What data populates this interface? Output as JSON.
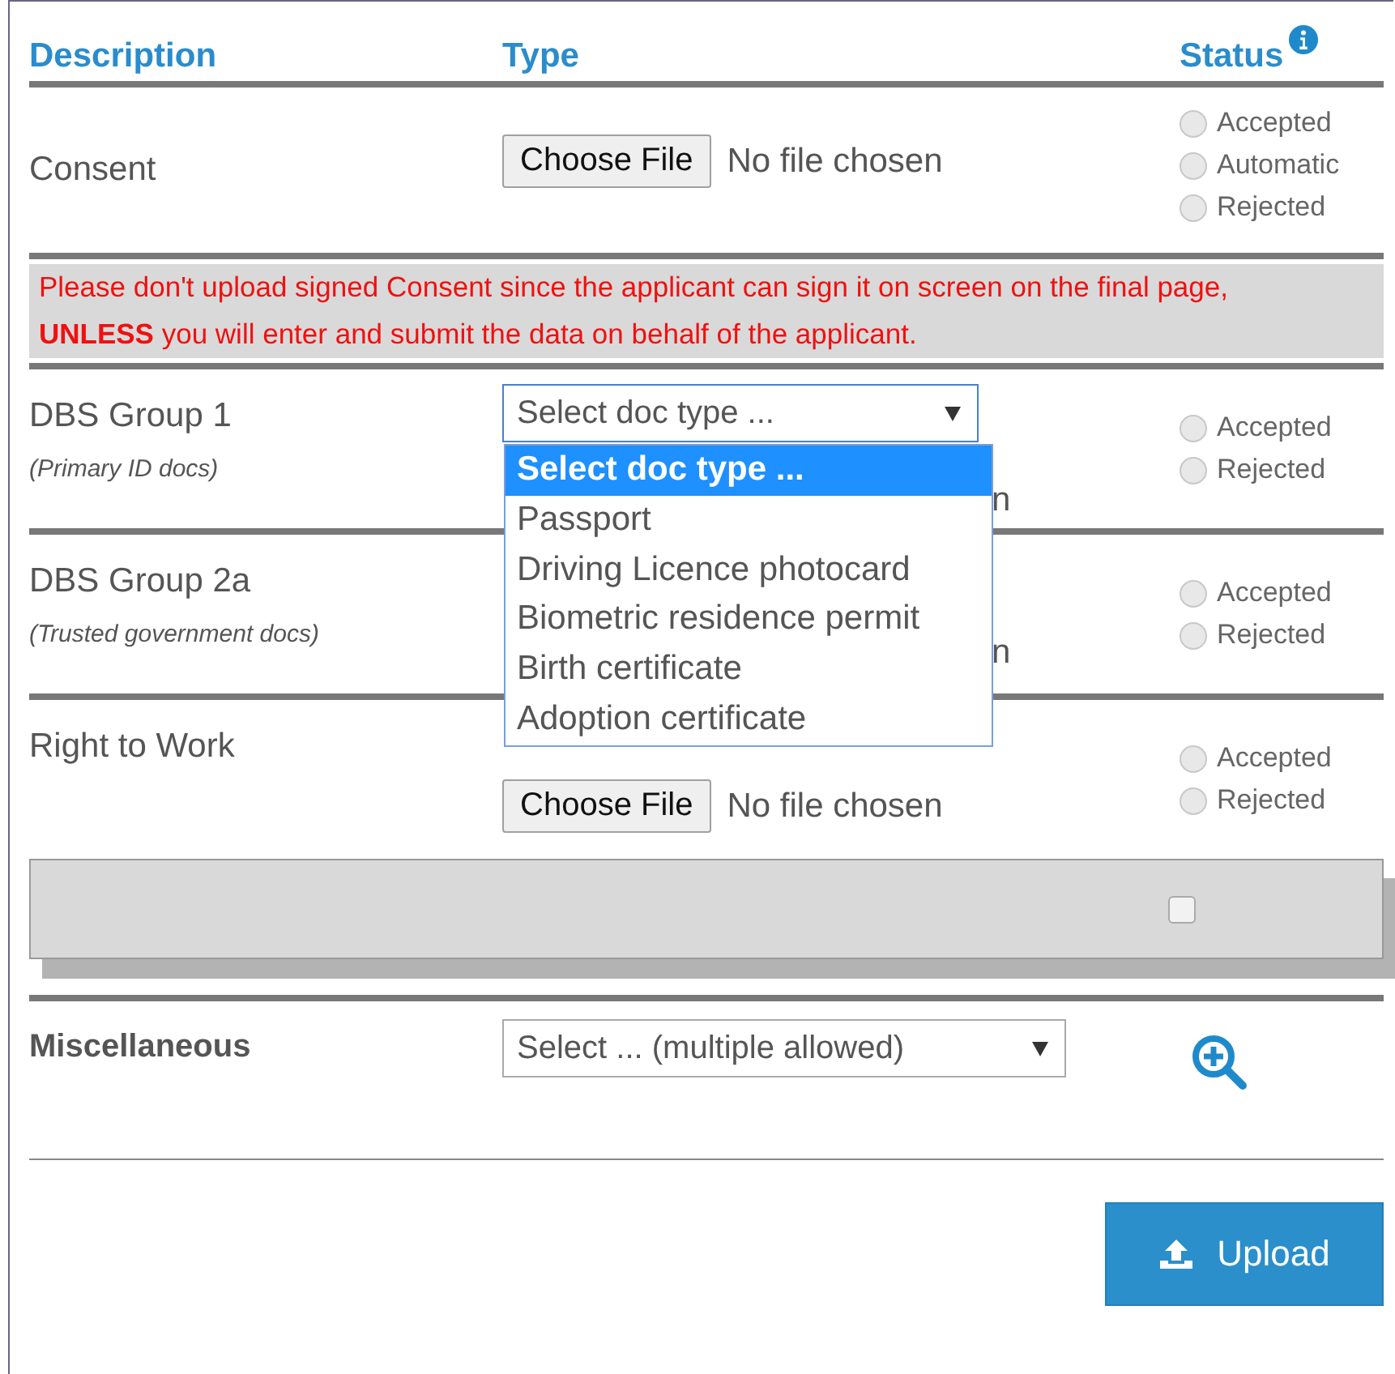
{
  "columns": [
    "Description",
    "Type",
    "Status"
  ],
  "rows": [
    {
      "kind": "upload",
      "label": "Consent",
      "controls": [
        {
          "kind": "file",
          "button": "Choose File",
          "value": "No file chosen"
        }
      ],
      "statuses": [
        {
          "label": "Accepted",
          "selected": false
        },
        {
          "label": "Automatic",
          "selected": false
        },
        {
          "label": "Rejected",
          "selected": false
        }
      ]
    },
    {
      "kind": "notice",
      "text": "Please don't upload signed Consent since the applicant can sign it on screen on the final page, **UNLESS** you will enter and submit the data on behalf of the applicant."
    },
    {
      "kind": "upload",
      "label": "DBS Group 1",
      "note": "(Primary ID docs)",
      "controls": [
        {
          "kind": "select",
          "value": "Select doc type ...",
          "expanded": true,
          "options": [
            {
              "label": "Select doc type ...",
              "selected": true
            },
            {
              "label": "Passport",
              "selected": false
            },
            {
              "label": "Driving Licence photocard",
              "selected": false
            },
            {
              "label": "Biometric residence permit",
              "selected": false
            },
            {
              "label": "Birth certificate",
              "selected": false
            },
            {
              "label": "Adoption certificate",
              "selected": false
            }
          ]
        },
        {
          "kind": "fragment",
          "value": "n"
        }
      ],
      "statuses": [
        {
          "label": "Accepted",
          "selected": false
        },
        {
          "label": "Rejected",
          "selected": false
        }
      ]
    },
    {
      "kind": "upload",
      "label": "DBS Group 2a",
      "note": "(Trusted government docs)",
      "controls": [
        {
          "kind": "fragment",
          "value": "n"
        }
      ],
      "statuses": [
        {
          "label": "Accepted",
          "selected": false
        },
        {
          "label": "Rejected",
          "selected": false
        }
      ]
    },
    {
      "kind": "upload",
      "label": "Right to Work",
      "controls": [
        {
          "kind": "file",
          "button": "Choose File",
          "value": "No file chosen"
        }
      ],
      "statuses": [
        {
          "label": "Accepted",
          "selected": false
        },
        {
          "label": "Rejected",
          "selected": false
        }
      ]
    },
    {
      "kind": "checkpanel",
      "checked": false
    },
    {
      "kind": "misc",
      "label": "Miscellaneous",
      "select": "Select ... (multiple allowed)"
    }
  ],
  "upload_button": "Upload"
}
